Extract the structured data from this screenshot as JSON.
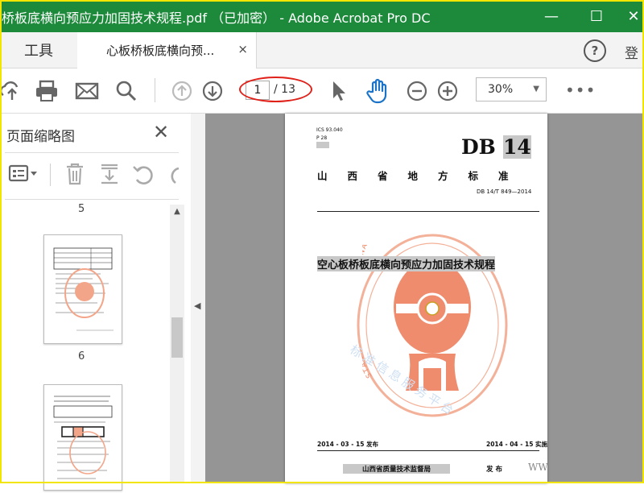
{
  "window": {
    "title": "桥板底横向预应力加固技术规程.pdf （已加密） - Adobe Acrobat Pro DC",
    "minimize_icon": "—",
    "maximize_icon": "☐",
    "close_icon": "✕",
    "colors": {
      "titlebar": "#1c8a3a",
      "highlight": "#e0211a"
    }
  },
  "tabs": {
    "tools_label": "工具",
    "doc_label": "心板桥板底横向预...",
    "doc_close": "×",
    "help_label": "?",
    "signin_label": "登"
  },
  "toolbar": {
    "page_current": "1",
    "page_total": "/ 13",
    "zoom": "30%",
    "zoom_caret": "▼",
    "more": "•••",
    "icons": [
      "upload-icon",
      "print-icon",
      "mail-icon",
      "search-icon",
      "prev-page-icon",
      "next-page-icon",
      "select-cursor-icon",
      "hand-icon",
      "zoom-out-icon",
      "zoom-in-icon"
    ]
  },
  "sidebar": {
    "title": "页面缩略图",
    "close": "✕",
    "thumbnails": [
      {
        "label": "5"
      },
      {
        "label": "6"
      }
    ],
    "tools": [
      "thumbnail-options-icon",
      "delete-icon",
      "extract-icon",
      "undo-icon",
      "redo-icon"
    ]
  },
  "document": {
    "ics": "ICS  93.040",
    "p": "P  28",
    "code_db": "DB",
    "code_num": "14",
    "standard_header": "山　　西　　省　　地　　方　　标　　准",
    "standard_no": "DB 14/T  849—2014",
    "title": "空心板桥板底横向预应力加固技术规程",
    "issue_date": "2014 - 03 - 15 发布",
    "impl_date": "2014 - 04 - 15 实施",
    "issuer": "山西省质量技术监督局",
    "issuer_suffix": "发  布",
    "seal_text": "STANDARDS PRESS OF CHINA",
    "watermark": "标准信息服务平台",
    "www": "WWW."
  }
}
